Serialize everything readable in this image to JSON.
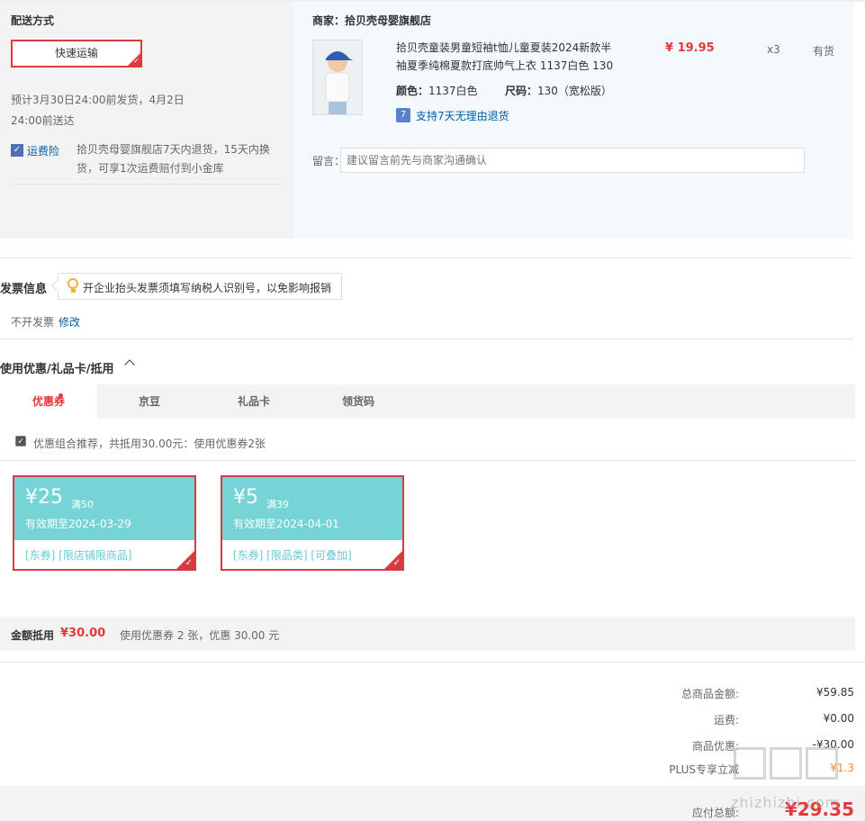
{
  "delivery": {
    "title": "配送方式",
    "method": "快速运输",
    "eta_line1": "预计3月30日24:00前发货，4月2日",
    "eta_line2": "24:00前送达",
    "insurance_label": "运费险",
    "insurance_line1": "拾贝壳母婴旗舰店7天内退货，15天内换",
    "insurance_line2": "货，可享1次运费赔付到小金库"
  },
  "product": {
    "merchant": "商家：拾贝壳母婴旗舰店",
    "name_line1": "拾贝壳童装男童短袖t恤儿童夏装2024新款半",
    "name_line2": "袖夏季纯棉夏款打底帅气上衣 1137白色 130",
    "price": "¥ 19.95",
    "qty": "x3",
    "stock": "有货",
    "color_label": "颜色：",
    "color_value": "1137白色",
    "size_label": "尺码：",
    "size_value": "130（宽松版）",
    "return_policy": "支持7天无理由退货",
    "memo_label": "留言：",
    "memo_placeholder": "建议留言前先与商家沟通确认"
  },
  "invoice": {
    "title": "发票信息",
    "tip": "开企业抬头发票须填写纳税人识别号，以免影响报销",
    "status": "不开发票",
    "edit": "修改"
  },
  "coupons": {
    "section_title": "使用优惠/礼品卡/抵用",
    "tabs": [
      "优惠券",
      "京豆",
      "礼品卡",
      "领货码"
    ],
    "combo_text": "优惠组合推荐，共抵用30.00元：使用优惠券2张",
    "items": [
      {
        "amount": "¥25",
        "condition": "满50",
        "expiry": "有效期至2024-03-29",
        "tags": "[东券]  [限店铺限商品]"
      },
      {
        "amount": "¥5",
        "condition": "满39",
        "expiry": "有效期至2024-04-01",
        "tags": "[东券]  [限品类]  [可叠加]"
      }
    ],
    "summary_label": "金额抵用",
    "summary_amount": "¥30.00",
    "summary_desc": "使用优惠券 2 张，优惠 30.00 元"
  },
  "totals": {
    "goods_label": "总商品金额:",
    "goods_value": "¥59.85",
    "freight_label": "运费:",
    "freight_value": "¥0.00",
    "discount_label": "商品优惠:",
    "discount_value": "-¥30.00",
    "plus_label": "PLUS专享立减",
    "plus_value": "¥1.3",
    "pay_label": "应付总额:",
    "pay_value": "¥29.35"
  },
  "watermark": "zhizhizhi.com",
  "colors": {
    "accent": "#e4393c",
    "link": "#005ea7",
    "coupon": "#76d3d6"
  }
}
